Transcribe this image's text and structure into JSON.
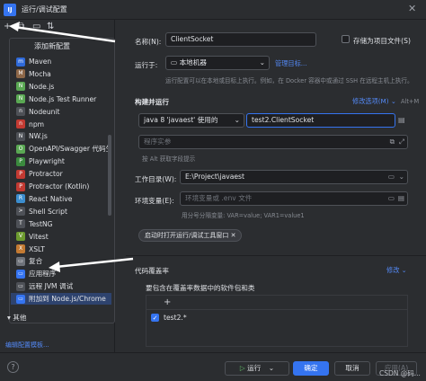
{
  "window": {
    "title": "运行/调试配置",
    "app_icon_text": "IJ"
  },
  "popup": {
    "title": "添加新配置",
    "items": [
      {
        "label": "Maven",
        "icon": "maven-icon",
        "color": "#2f6ad9",
        "glyph": "m"
      },
      {
        "label": "Mocha",
        "icon": "mocha-icon",
        "color": "#8d6748",
        "glyph": "M"
      },
      {
        "label": "Node.js",
        "icon": "nodejs-icon",
        "color": "#5aa853",
        "glyph": "N"
      },
      {
        "label": "Node.js Test Runner",
        "icon": "nodejs-test-icon",
        "color": "#5aa853",
        "glyph": "N"
      },
      {
        "label": "Nodeunit",
        "icon": "nodeunit-icon",
        "color": "#4e5157",
        "glyph": "n"
      },
      {
        "label": "npm",
        "icon": "npm-icon",
        "color": "#c33a32",
        "glyph": "n"
      },
      {
        "label": "NW.js",
        "icon": "nwjs-icon",
        "color": "#4e5157",
        "glyph": "N"
      },
      {
        "label": "OpenAPI/Swagger 代码生成",
        "icon": "openapi-icon",
        "color": "#5aa853",
        "glyph": "O"
      },
      {
        "label": "Playwright",
        "icon": "playwright-icon",
        "color": "#3b8a3e",
        "glyph": "P"
      },
      {
        "label": "Protractor",
        "icon": "protractor-icon",
        "color": "#c33a32",
        "glyph": "P"
      },
      {
        "label": "Protractor (Kotlin)",
        "icon": "protractor-kotlin-icon",
        "color": "#c33a32",
        "glyph": "P"
      },
      {
        "label": "React Native",
        "icon": "react-icon",
        "color": "#3c8ecf",
        "glyph": "R"
      },
      {
        "label": "Shell Script",
        "icon": "shell-icon",
        "color": "#4e5157",
        "glyph": ">"
      },
      {
        "label": "TestNG",
        "icon": "testng-icon",
        "color": "#4e5157",
        "glyph": "T"
      },
      {
        "label": "Vitest",
        "icon": "vitest-icon",
        "color": "#6d9b2f",
        "glyph": "V"
      },
      {
        "label": "XSLT",
        "icon": "xslt-icon",
        "color": "#c37a32",
        "glyph": "X"
      },
      {
        "label": "复合",
        "icon": "folder-icon",
        "color": "#6f737a",
        "glyph": "▭"
      },
      {
        "label": "应用程序",
        "icon": "application-icon",
        "color": "#3574f0",
        "glyph": "▭"
      },
      {
        "label": "远程 JVM 调试",
        "icon": "remote-jvm-icon",
        "color": "#4e5157",
        "glyph": "▭"
      },
      {
        "label": "附加到 Node.js/Chrome",
        "icon": "attach-node-icon",
        "color": "#3574f0",
        "glyph": "▭",
        "selected": true
      }
    ],
    "other": "其他"
  },
  "edit_templates": "编辑配置模板...",
  "form": {
    "name_label": "名称(N):",
    "name_value": "ClientSocket",
    "store_label": "存储为项目文件(S)",
    "run_on_label": "运行于:",
    "run_on_value": "本地机器",
    "manage_targets": "管理目标...",
    "run_on_hint": "运行配置可以在本地或目标上执行。例如，在 Docker 容器中或通过 SSH 在远程主机上执行。",
    "build_run_title": "构建并运行",
    "modify_options": "修改选项(M)",
    "modify_shortcut": "Alt+M",
    "jdk_value": "java 8 'javaest' 使用的",
    "main_class": "test2.ClientSocket",
    "program_args_placeholder": "程序实参",
    "program_args_hint": "按 Alt 获取字段提示",
    "workdir_label": "工作目录(W):",
    "workdir_value": "E:\\Project\\javaest",
    "env_label": "环境变量(E):",
    "env_placeholder": "环境变量或 .env 文件",
    "env_hint": "用分号分隔变量: VAR=value; VAR1=value1",
    "chip_label": "启动时打开运行/调试工具窗口",
    "coverage_title": "代码覆盖率",
    "coverage_modify": "修改",
    "coverage_include_label": "要包含在覆盖率数据中的软件包和类",
    "coverage_add": "+",
    "coverage_entry": "test2.*"
  },
  "footer": {
    "help": "?",
    "run_button": "运行",
    "ok_button": "确定",
    "cancel_button": "取消",
    "apply_button": "应用(A)"
  },
  "watermark": "CSDN @码..."
}
